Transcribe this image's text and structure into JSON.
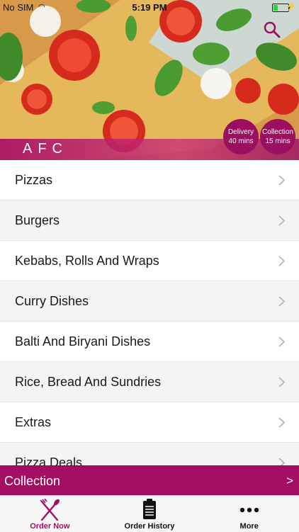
{
  "status_bar": {
    "carrier": "No SIM",
    "time": "5:19 PM"
  },
  "restaurant": {
    "name": "AFC",
    "delivery_label": "Delivery",
    "delivery_time": "40 mins",
    "collection_label": "Collection",
    "collection_time": "15 mins"
  },
  "menu": {
    "categories": [
      "Pizzas",
      "Burgers",
      "Kebabs, Rolls And Wraps",
      "Curry Dishes",
      "Balti And Biryani Dishes",
      "Rice, Bread And Sundries",
      "Extras",
      "Pizza Deals"
    ]
  },
  "order_mode": {
    "label": "Collection",
    "arrow": ">"
  },
  "tab_bar": {
    "tabs": [
      {
        "label": "Order Now",
        "icon": "fork-knife-icon",
        "active": true
      },
      {
        "label": "Order History",
        "icon": "receipt-icon",
        "active": false
      },
      {
        "label": "More",
        "icon": "more-dots-icon",
        "active": false
      }
    ]
  },
  "colors": {
    "accent": "#a30e63",
    "badge": "#9b0f5f"
  },
  "icons": {
    "search": "search-icon",
    "chevron": "chevron-right-icon"
  }
}
